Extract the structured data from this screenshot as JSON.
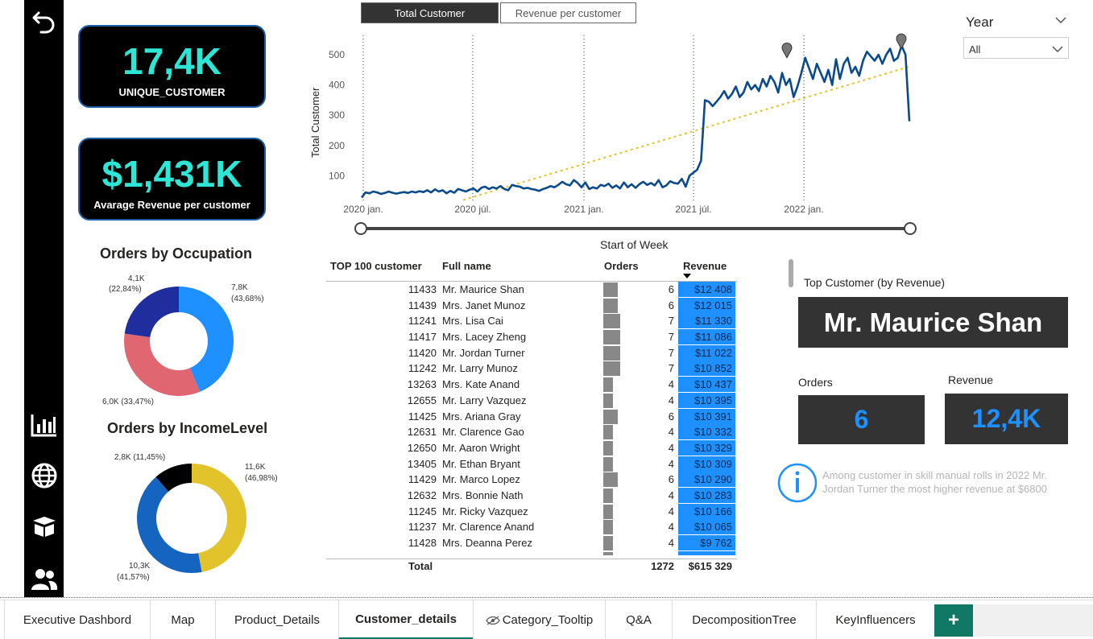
{
  "kpis": {
    "unique_customer": {
      "value": "17,4K",
      "label": "UNIQUE_CUSTOMER"
    },
    "avg_revenue": {
      "value": "$1,431K",
      "label": "Avarage Revenue per customer"
    }
  },
  "donut_occupation": {
    "title": "Orders by Occupation",
    "labels": [
      "7,8K",
      "(43,68%)",
      "6,0K (33,47%)",
      "4,1K",
      "(22,84%)"
    ]
  },
  "donut_income": {
    "title": "Orders by IncomeLevel",
    "labels": [
      "11,6K",
      "(46,98%)",
      "10,3K",
      "(41,57%)",
      "2,8K (11,45%)"
    ]
  },
  "toggle": {
    "total_customer": "Total Customer",
    "revenue_per_customer": "Revenue per customer"
  },
  "line_chart": {
    "ylabel": "Total Customer",
    "xlabel": "Start of Week",
    "yticks": [
      "500",
      "400",
      "300",
      "200",
      "100"
    ],
    "xticks": [
      "2020 jan.",
      "2020 júl.",
      "2021 jan.",
      "2021 júl.",
      "2022 jan."
    ]
  },
  "chart_data": {
    "type": "line",
    "xlabel": "Start of Week",
    "ylabel": "Total Customer",
    "ylim": [
      0,
      560
    ],
    "series": [
      {
        "name": "Total Customer",
        "x_range": [
          "2020 jan.",
          "2022 jún."
        ],
        "values": [
          28,
          45,
          42,
          48,
          45,
          40,
          43,
          48,
          44,
          41,
          44,
          46,
          43,
          48,
          45,
          49,
          46,
          52,
          45,
          55,
          48,
          52,
          42,
          50,
          44,
          56,
          52,
          48,
          54,
          58,
          48,
          60,
          64,
          56,
          62,
          58,
          66,
          56,
          52,
          70,
          66,
          64,
          58,
          60,
          56,
          54,
          50,
          56,
          60,
          66,
          62,
          70,
          80,
          72,
          68,
          86,
          76,
          62,
          78,
          56,
          62,
          58,
          70,
          66,
          74,
          60,
          68,
          58,
          78,
          62,
          72,
          60,
          72,
          80,
          70,
          76,
          68,
          86,
          62,
          68,
          82,
          76,
          74,
          90,
          64,
          100,
          110,
          120,
          150,
          350,
          345,
          330,
          345,
          360,
          380,
          355,
          370,
          395,
          360,
          375,
          410,
          385,
          400,
          380,
          420,
          395,
          430,
          410,
          375,
          440,
          400,
          420,
          360,
          395,
          440,
          490,
          455,
          420,
          470,
          440,
          410,
          450,
          400,
          485,
          420,
          470,
          490,
          440,
          460,
          430,
          480,
          510,
          495,
          480,
          500,
          470,
          500,
          520,
          480,
          490,
          530,
          500,
          280
        ]
      },
      {
        "name": "Trend",
        "values": [
          20,
          460
        ],
        "style": "dotted"
      }
    ],
    "markers": [
      "2021 dec.",
      "2022 jún."
    ]
  },
  "slicer": {
    "title": "Year",
    "value": "All"
  },
  "table": {
    "headers": [
      "TOP 100 customer",
      "Full name",
      "Orders",
      "Revenue"
    ],
    "rows": [
      {
        "id": "11433",
        "name": "Mr. Maurice Shan",
        "orders": 6,
        "revenue": "$12 408"
      },
      {
        "id": "11439",
        "name": "Mrs. Janet Munoz",
        "orders": 6,
        "revenue": "$12 015"
      },
      {
        "id": "11241",
        "name": "Mrs. Lisa Cai",
        "orders": 7,
        "revenue": "$11 330"
      },
      {
        "id": "11417",
        "name": "Mrs. Lacey Zheng",
        "orders": 7,
        "revenue": "$11 086"
      },
      {
        "id": "11420",
        "name": "Mr. Jordan Turner",
        "orders": 7,
        "revenue": "$11 022"
      },
      {
        "id": "11242",
        "name": "Mr. Larry Munoz",
        "orders": 7,
        "revenue": "$10 852"
      },
      {
        "id": "13263",
        "name": "Mrs. Kate Anand",
        "orders": 4,
        "revenue": "$10 437"
      },
      {
        "id": "12655",
        "name": "Mr. Larry Vazquez",
        "orders": 4,
        "revenue": "$10 395"
      },
      {
        "id": "11425",
        "name": "Mrs. Ariana Gray",
        "orders": 6,
        "revenue": "$10 391"
      },
      {
        "id": "12631",
        "name": "Mr. Clarence Gao",
        "orders": 4,
        "revenue": "$10 332"
      },
      {
        "id": "12650",
        "name": "Mr. Aaron Wright",
        "orders": 4,
        "revenue": "$10 329"
      },
      {
        "id": "13405",
        "name": "Mr. Ethan Bryant",
        "orders": 4,
        "revenue": "$10 309"
      },
      {
        "id": "11429",
        "name": "Mr. Marco Lopez",
        "orders": 6,
        "revenue": "$10 290"
      },
      {
        "id": "12632",
        "name": "Mrs. Bonnie Nath",
        "orders": 4,
        "revenue": "$10 283"
      },
      {
        "id": "11245",
        "name": "Mr. Ricky Vazquez",
        "orders": 4,
        "revenue": "$10 166"
      },
      {
        "id": "11237",
        "name": "Mr. Clarence Anand",
        "orders": 4,
        "revenue": "$10 065"
      },
      {
        "id": "11428",
        "name": "Mrs. Deanna Perez",
        "orders": 4,
        "revenue": "$9 762"
      }
    ],
    "total_label": "Total",
    "total_orders": "1272",
    "total_revenue": "$615 329"
  },
  "top_customer": {
    "title": "Top Customer (by Revenue)",
    "name": "Mr. Maurice Shan",
    "orders_label": "Orders",
    "orders_value": "6",
    "revenue_label": "Revenue",
    "revenue_value": "12,4K"
  },
  "info_text": "Among customer in skill manual rolls in 2022 Mr. Jordan Turner the most higher revenue at $6800",
  "tabs": [
    "Executive Dashbord",
    "Map",
    "Product_Details",
    "Customer_details",
    "Category_Tooltip",
    "Q&A",
    "DecompositionTree",
    "KeyInfluencers"
  ],
  "active_tab": "Customer_details",
  "colors": {
    "accent": "#2ee6d6",
    "line": "#0b4a8b",
    "trend": "#e3c32c",
    "revenue_bar": "#1e90ff",
    "tab_active": "#117865"
  }
}
